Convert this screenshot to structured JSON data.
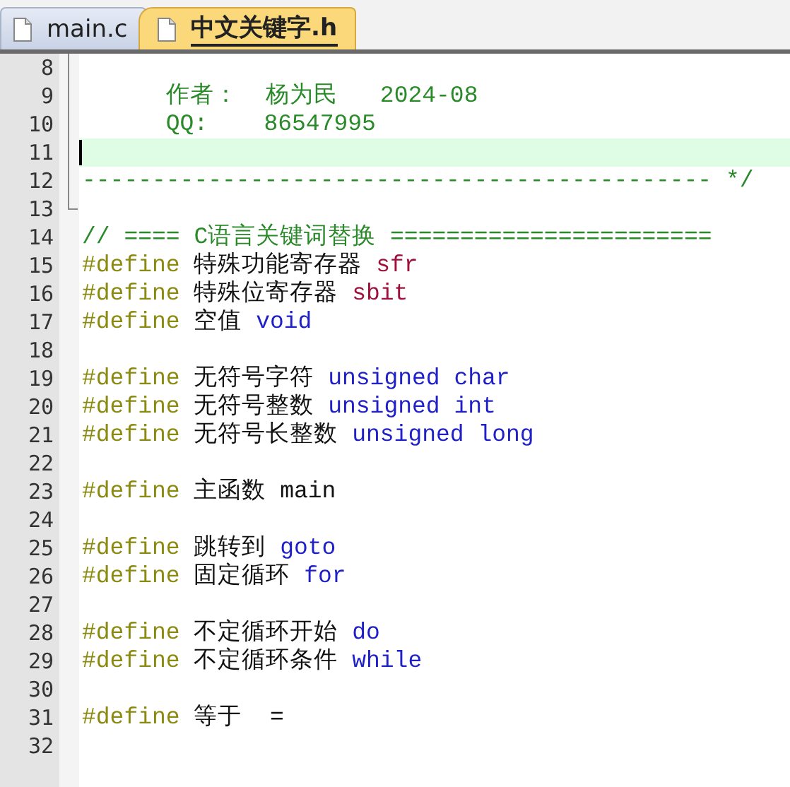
{
  "tabs": [
    {
      "label": "main.c",
      "selected": false
    },
    {
      "label": "中文关键字.h",
      "selected": true
    }
  ],
  "editor": {
    "lines": [
      {
        "number": "8"
      },
      {
        "number": "9",
        "tokens": [
          {
            "kind": "comment",
            "text": "      作者：  杨为民   2024-08"
          }
        ]
      },
      {
        "number": "10",
        "tokens": [
          {
            "kind": "comment",
            "text": "      QQ:    86547995"
          }
        ]
      },
      {
        "number": "11",
        "current": true
      },
      {
        "number": "12",
        "tokens": [
          {
            "kind": "comment",
            "text": "--------------------------------------------- */"
          }
        ]
      },
      {
        "number": "13"
      },
      {
        "number": "14",
        "tokens": [
          {
            "kind": "comment",
            "text": "// ==== C语言关键词替换 ======================="
          }
        ]
      },
      {
        "number": "15",
        "tokens": [
          {
            "kind": "preprocessor",
            "text": "#define"
          },
          {
            "kind": "text",
            "text": "特殊功能寄存器"
          },
          {
            "kind": "register",
            "text": "sfr"
          }
        ]
      },
      {
        "number": "16",
        "tokens": [
          {
            "kind": "preprocessor",
            "text": "#define"
          },
          {
            "kind": "text",
            "text": "特殊位寄存器"
          },
          {
            "kind": "register",
            "text": "sbit"
          }
        ]
      },
      {
        "number": "17",
        "tokens": [
          {
            "kind": "preprocessor",
            "text": "#define"
          },
          {
            "kind": "text",
            "text": "空值"
          },
          {
            "kind": "keyword",
            "text": "void"
          }
        ]
      },
      {
        "number": "18"
      },
      {
        "number": "19",
        "tokens": [
          {
            "kind": "preprocessor",
            "text": "#define"
          },
          {
            "kind": "text",
            "text": "无符号字符"
          },
          {
            "kind": "keyword",
            "text": "unsigned char"
          }
        ]
      },
      {
        "number": "20",
        "tokens": [
          {
            "kind": "preprocessor",
            "text": "#define"
          },
          {
            "kind": "text",
            "text": "无符号整数"
          },
          {
            "kind": "keyword",
            "text": "unsigned int"
          }
        ]
      },
      {
        "number": "21",
        "tokens": [
          {
            "kind": "preprocessor",
            "text": "#define"
          },
          {
            "kind": "text",
            "text": "无符号长整数"
          },
          {
            "kind": "keyword",
            "text": "unsigned long"
          }
        ]
      },
      {
        "number": "22"
      },
      {
        "number": "23",
        "tokens": [
          {
            "kind": "preprocessor",
            "text": "#define"
          },
          {
            "kind": "text",
            "text": "主函数"
          },
          {
            "kind": "text",
            "text": "main"
          }
        ]
      },
      {
        "number": "24"
      },
      {
        "number": "25",
        "tokens": [
          {
            "kind": "preprocessor",
            "text": "#define"
          },
          {
            "kind": "text",
            "text": "跳转到"
          },
          {
            "kind": "keyword",
            "text": "goto"
          }
        ]
      },
      {
        "number": "26",
        "tokens": [
          {
            "kind": "preprocessor",
            "text": "#define"
          },
          {
            "kind": "text",
            "text": "固定循环"
          },
          {
            "kind": "keyword",
            "text": "for"
          }
        ]
      },
      {
        "number": "27"
      },
      {
        "number": "28",
        "tokens": [
          {
            "kind": "preprocessor",
            "text": "#define"
          },
          {
            "kind": "text",
            "text": "不定循环开始"
          },
          {
            "kind": "keyword",
            "text": "do"
          }
        ]
      },
      {
        "number": "29",
        "tokens": [
          {
            "kind": "preprocessor",
            "text": "#define"
          },
          {
            "kind": "text",
            "text": "不定循环条件"
          },
          {
            "kind": "keyword",
            "text": "while"
          }
        ]
      },
      {
        "number": "30"
      },
      {
        "number": "31",
        "tokens": [
          {
            "kind": "preprocessor",
            "text": "#define"
          },
          {
            "kind": "text",
            "text": "等于"
          },
          {
            "kind": "text",
            "text": " ="
          }
        ]
      },
      {
        "number": "32"
      }
    ]
  }
}
